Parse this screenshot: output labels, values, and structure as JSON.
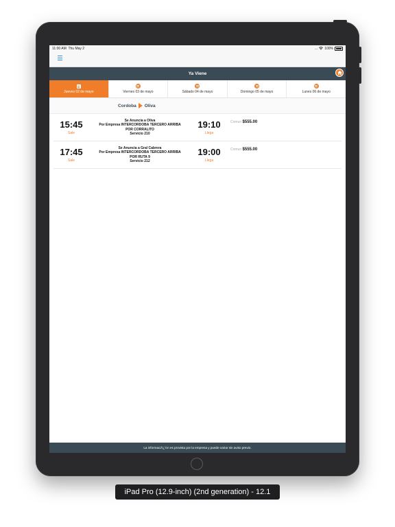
{
  "statusbar": {
    "time": "11:00 AM",
    "date": "Thu May 2",
    "signal": "...",
    "battery": "100%"
  },
  "header": {
    "title": "Ya Viene"
  },
  "tabs": [
    {
      "label": "Jueves 02 de mayo",
      "active": true
    },
    {
      "label": "Viernes 03 de mayo",
      "active": false
    },
    {
      "label": "Sábado 04 de mayo",
      "active": false
    },
    {
      "label": "Domingo 05 de mayo",
      "active": false
    },
    {
      "label": "Lunes 06 de mayo",
      "active": false
    }
  ],
  "route": {
    "origin": "Cordoba",
    "destination": "Oliva"
  },
  "trips": [
    {
      "depart": "15:45",
      "depart_label": "Sale",
      "line1": "Se Anuncia a Oliva",
      "line2": "Por Empresa INTERCORDOBA TERCERO ARRIBA",
      "line3": "POR CORRALITO",
      "line4": "Servicio 210",
      "arrive": "19:10",
      "arrive_label": "Llega",
      "price_type": "Comun",
      "price": "$555.00"
    },
    {
      "depart": "17:45",
      "depart_label": "Sale",
      "line1": "Se Anuncia a Gral Cabrera",
      "line2": "Por Empresa INTERCORDOBA TERCERO ARRIBA",
      "line3": "POR RUTA 9",
      "line4": "Servicio 212",
      "arrive": "19:00",
      "arrive_label": "Llega",
      "price_type": "Comun",
      "price": "$555.00"
    }
  ],
  "footer": {
    "text": "La informaciÃ¿½n es provista por la empresa y puede variar sin aviso previo."
  },
  "caption": {
    "text": "iPad Pro (12.9-inch) (2nd generation) - 12.1"
  },
  "colors": {
    "accent": "#ef7d2a",
    "header_bg": "#3a4b55"
  },
  "icons": {
    "menu": "hamburger-icon",
    "home": "home-icon",
    "tab": "calendar-icon"
  }
}
